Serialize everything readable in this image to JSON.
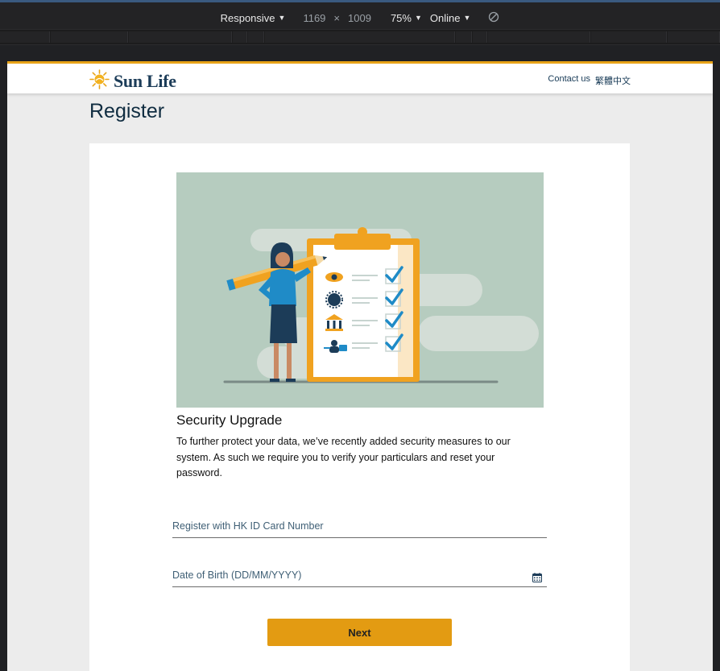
{
  "devtools": {
    "device": "Responsive",
    "width": "1169",
    "times": "×",
    "height": "1009",
    "zoom": "75%",
    "network": "Online"
  },
  "header": {
    "logo_text": "Sun Life",
    "contact_label": "Contact us",
    "language_label": "繁體中文"
  },
  "page": {
    "title": "Register"
  },
  "security": {
    "title": "Security Upgrade",
    "description": "To further protect your data, we’ve recently added security measures to our system. As such we require you to verify your particulars and reset your password."
  },
  "form": {
    "id_label": "Register with HK ID Card Number",
    "dob_label": "Date of Birth (DD/MM/YYYY)",
    "next_label": "Next"
  },
  "colors": {
    "brand_gold": "#e39b12",
    "brand_navy": "#173a56",
    "illustration_bg": "#b6ccbf",
    "check_blue": "#1f8bc7"
  },
  "icons": [
    "sun-logo-icon",
    "caret-down-icon",
    "rotate-icon",
    "calendar-icon",
    "eye-icon",
    "globe-icon",
    "bank-icon",
    "key-user-icon",
    "check-icon"
  ]
}
